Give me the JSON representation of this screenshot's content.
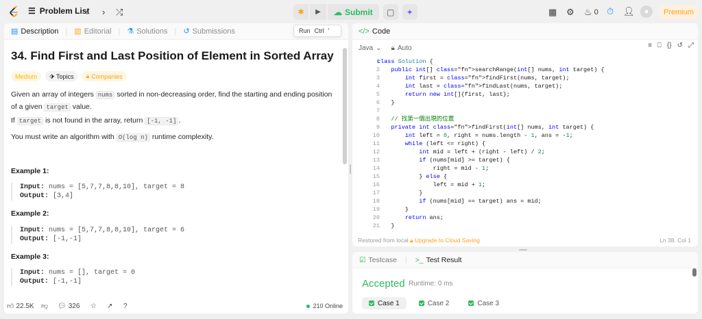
{
  "topbar": {
    "problem_list_label": "Problem List",
    "submit_label": "Submit",
    "streak_count": "0",
    "premium_label": "Premium"
  },
  "left_tabs": [
    {
      "label": "Description"
    },
    {
      "label": "Editorial"
    },
    {
      "label": "Solutions"
    },
    {
      "label": "Submissions"
    }
  ],
  "run_tooltip": {
    "run": "Run",
    "ctrl": "Ctrl",
    "key": "'"
  },
  "problem": {
    "title": "34. Find First and Last Position of Element in Sorted Array",
    "difficulty": "Medium",
    "topics": "Topics",
    "companies": "Companies",
    "desc1_a": "Given an array of integers ",
    "desc1_code": "nums",
    "desc1_b": " sorted in non-decreasing order, find the starting and ending position of a given",
    "desc1_code2": "target",
    "desc1_c": " value.",
    "desc2_a": "If ",
    "desc2_code": "target",
    "desc2_b": " is not found in the array, return ",
    "desc2_code2": "[-1, -1]",
    "desc2_c": ".",
    "desc3_a": "You must write an algorithm with ",
    "desc3_code": "O(log n)",
    "desc3_b": " runtime complexity."
  },
  "examples": [
    {
      "title": "Example 1:",
      "input_label": "Input:",
      "input": " nums = [5,7,7,8,8,10], target = 8",
      "output_label": "Output:",
      "output": " [3,4]"
    },
    {
      "title": "Example 2:",
      "input_label": "Input:",
      "input": " nums = [5,7,7,8,8,10], target = 6",
      "output_label": "Output:",
      "output": " [-1,-1]"
    },
    {
      "title": "Example 3:",
      "input_label": "Input:",
      "input": " nums = [], target = 0",
      "output_label": "Output:",
      "output": " [-1,-1]"
    }
  ],
  "left_footer": {
    "likes": "22.5K",
    "comments": "326",
    "online": "210 Online"
  },
  "code_panel": {
    "tab_label": "Code",
    "language": "Java",
    "mode": "Auto",
    "restored": "Restored from local",
    "upgrade": "Upgrade to Cloud Saving",
    "cursor": "Ln 38, Col 1"
  },
  "code_lines": [
    "class Solution {",
    "    public int[] searchRange(int[] nums, int target) {",
    "        int first = findFirst(nums, target);",
    "        int last = findLast(nums, target);",
    "        return new int[]{first, last};",
    "    }",
    "",
    "    // 找第一個出現的位置",
    "    private int findFirst(int[] nums, int target) {",
    "        int left = 0, right = nums.length - 1, ans = -1;",
    "        while (left <= right) {",
    "            int mid = left + (right - left) / 2;",
    "            if (nums[mid] >= target) {",
    "                right = mid - 1;",
    "            } else {",
    "                left = mid + 1;",
    "            }",
    "            if (nums[mid] == target) ans = mid;",
    "        }",
    "        return ans;",
    "    }"
  ],
  "result": {
    "testcase_tab": "Testcase",
    "result_tab": "Test Result",
    "status": "Accepted",
    "runtime": "Runtime: 0 ms",
    "cases": [
      "Case 1",
      "Case 2",
      "Case 3"
    ]
  },
  "colors": {
    "accent": "#2cbb5d",
    "premium": "#ffa116",
    "medium": "#ffb800"
  }
}
